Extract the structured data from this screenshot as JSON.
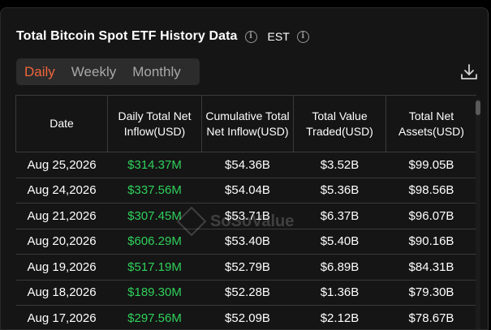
{
  "header": {
    "title": "Total Bitcoin Spot ETF History Data",
    "timezone": "EST"
  },
  "tabs": [
    {
      "label": "Daily",
      "active": true
    },
    {
      "label": "Weekly",
      "active": false
    },
    {
      "label": "Monthly",
      "active": false
    }
  ],
  "colors": {
    "accent": "#f0663a",
    "positive": "#2fd05b",
    "background": "#151515"
  },
  "table": {
    "columns": [
      "Date",
      "Daily Total Net Inflow(USD)",
      "Cumulative Total Net Inflow(USD)",
      "Total Value Traded(USD)",
      "Total Net Assets(USD)"
    ],
    "rows": [
      {
        "date": "Aug 25,2026",
        "inflow": "$314.37M",
        "cumulative": "$54.36B",
        "traded": "$3.52B",
        "assets": "$99.05B"
      },
      {
        "date": "Aug 24,2026",
        "inflow": "$337.56M",
        "cumulative": "$54.04B",
        "traded": "$5.36B",
        "assets": "$98.56B"
      },
      {
        "date": "Aug 21,2026",
        "inflow": "$307.45M",
        "cumulative": "$53.71B",
        "traded": "$6.37B",
        "assets": "$96.07B"
      },
      {
        "date": "Aug 20,2026",
        "inflow": "$606.29M",
        "cumulative": "$53.40B",
        "traded": "$5.40B",
        "assets": "$90.16B"
      },
      {
        "date": "Aug 19,2026",
        "inflow": "$517.19M",
        "cumulative": "$52.79B",
        "traded": "$6.89B",
        "assets": "$84.31B"
      },
      {
        "date": "Aug 18,2026",
        "inflow": "$189.30M",
        "cumulative": "$52.28B",
        "traded": "$1.36B",
        "assets": "$79.30B"
      },
      {
        "date": "Aug 17,2026",
        "inflow": "$297.56M",
        "cumulative": "$52.09B",
        "traded": "$2.12B",
        "assets": "$78.67B"
      }
    ]
  },
  "watermark": "SoSoValue",
  "icons": {
    "info": "info-icon",
    "download": "download-icon"
  }
}
